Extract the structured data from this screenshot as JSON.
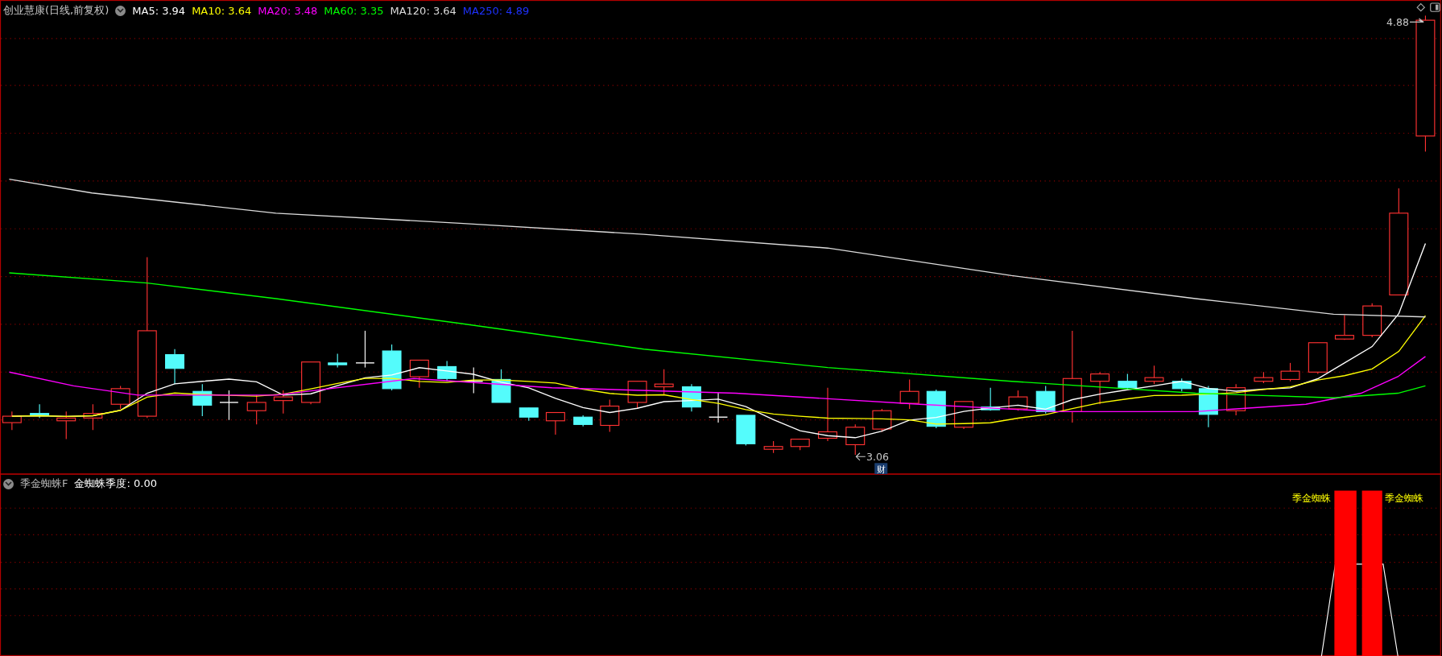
{
  "main_panel": {
    "title": "创业慧康(日线,前复权)",
    "indicators": [
      {
        "label": "MA5: 3.94",
        "color": "#ffffff"
      },
      {
        "label": "MA10: 3.64",
        "color": "#ffff00"
      },
      {
        "label": "MA20: 3.48",
        "color": "#ff00ff"
      },
      {
        "label": "MA60: 3.35",
        "color": "#00ff00"
      },
      {
        "label": "MA120: 3.64",
        "color": "#dcdcdc"
      },
      {
        "label": "MA250: 4.89",
        "color": "#1e32ff"
      }
    ],
    "high_label": "4.88",
    "low_label": "3.06",
    "event_badge": "财"
  },
  "sub_panel": {
    "title": "季金蜘蛛F",
    "indicator": "金蜘蛛季度: 0.00",
    "signal_labels": [
      "季金蜘蛛",
      "季金蜘蛛"
    ]
  }
}
